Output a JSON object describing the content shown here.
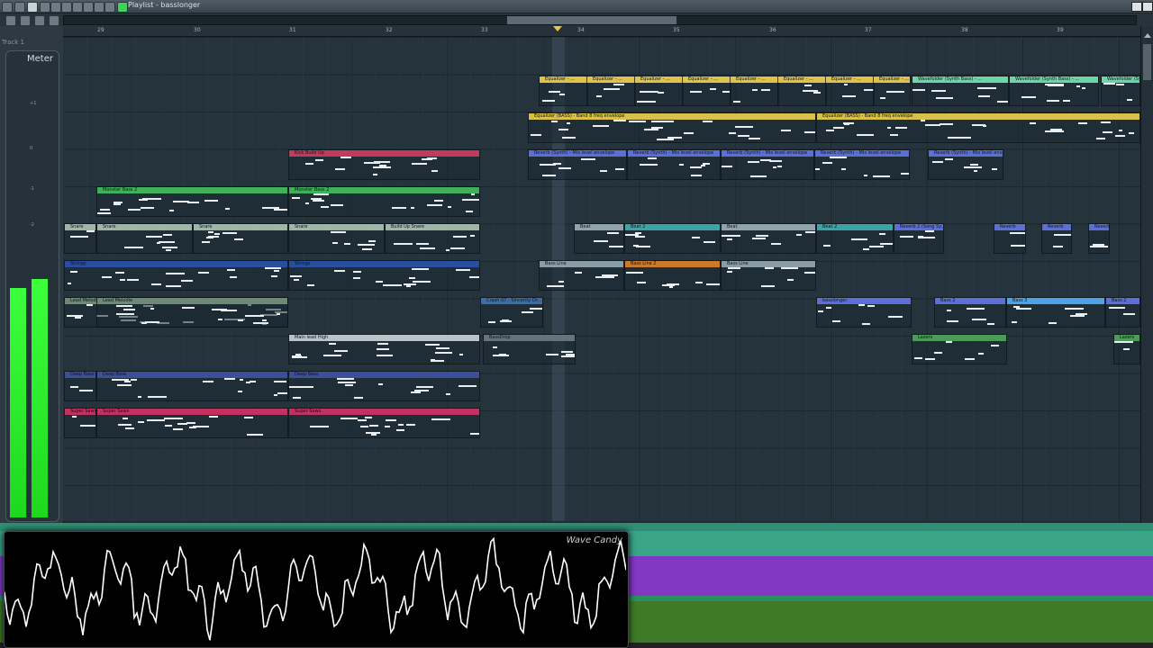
{
  "window": {
    "title": "Playlist - basslonger",
    "menu_label": "Track 1"
  },
  "meter": {
    "title": "Meter",
    "scale": [
      "+1",
      "0",
      "-1",
      "-2"
    ],
    "left_level": 0.5,
    "right_level": 0.52
  },
  "ruler": {
    "bars": [
      "29",
      "30",
      "31",
      "32",
      "33",
      "34",
      "35",
      "36",
      "37",
      "38",
      "39"
    ]
  },
  "wave_candy": {
    "title": "Wave Candy"
  },
  "colors": {
    "accent": "#f2c23a",
    "meter_green": "#3cff3c",
    "bg": "#24333c"
  },
  "clips": [
    {
      "label": "Equalizer - ...",
      "color": "#e0c24a"
    },
    {
      "label": "Wavefolder (Synth Bass) - ...",
      "color": "#6fd4a8"
    },
    {
      "label": "Equalizer (BASS) - Band 8 freq envelope",
      "color": "#d8c04a"
    },
    {
      "label": "Reverb (Synth) - Mix level envelope",
      "color": "#5b6fd6"
    },
    {
      "label": "Kick Build Up",
      "color": "#c23a5e"
    },
    {
      "label": "Monster Bass 2",
      "color": "#41b05a"
    },
    {
      "label": "Snare",
      "color": "#9fb5a6"
    },
    {
      "label": "Build Up Snare",
      "color": "#9fb5a6"
    },
    {
      "label": "Beat",
      "color": "#8fa3ad"
    },
    {
      "label": "Beat 2",
      "color": "#3aa4a6"
    },
    {
      "label": "Strings",
      "color": "#2a4d9c"
    },
    {
      "label": "Bass Line",
      "color": "#8a9ca6"
    },
    {
      "label": "Bass Line 2",
      "color": "#c97a2a"
    },
    {
      "label": "Lead Melodie",
      "color": "#6c8a73"
    },
    {
      "label": "Crash 07 - Sincerity Dr...",
      "color": "#3b6ea8"
    },
    {
      "label": "basslonger",
      "color": "#5c6fd8"
    },
    {
      "label": "Bass 2",
      "color": "#5c6fd8"
    },
    {
      "label": "Bass 3",
      "color": "#4aa2e8"
    },
    {
      "label": "Main lead High",
      "color": "#b7c3c9"
    },
    {
      "label": "BassDrop",
      "color": "#65737a"
    },
    {
      "label": "Lazers",
      "color": "#4c9b58"
    },
    {
      "label": "Deep Bass",
      "color": "#3c4f9c"
    },
    {
      "label": "Super Saws",
      "color": "#c2325e"
    },
    {
      "label": "Reverb 2 (Song Sy...",
      "color": "#5b6fd6"
    },
    {
      "label": "Reverb",
      "color": "#5b6fd6"
    }
  ]
}
